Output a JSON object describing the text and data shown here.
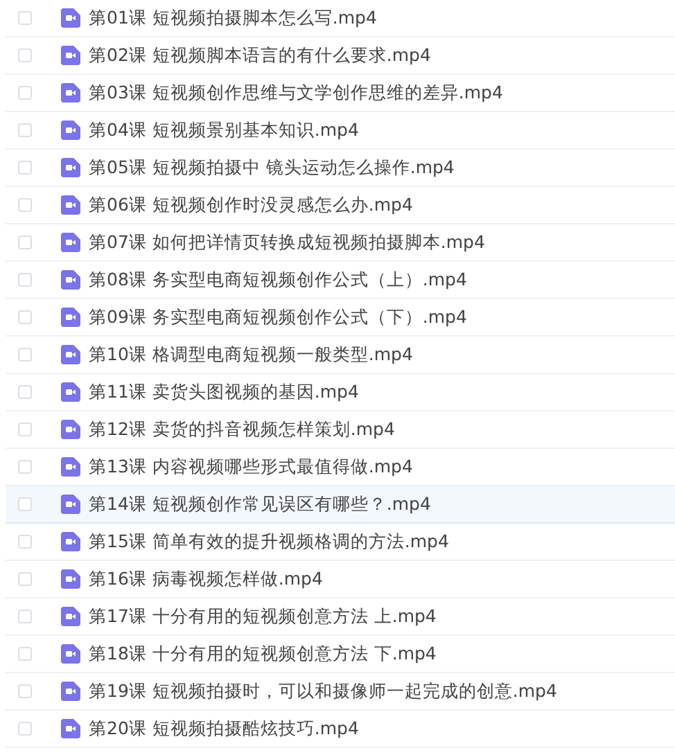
{
  "files": [
    {
      "name": "第01课 短视频拍摄脚本怎么写.mp4",
      "checked": false,
      "selected": false
    },
    {
      "name": "第02课 短视频脚本语言的有什么要求.mp4",
      "checked": false,
      "selected": false
    },
    {
      "name": "第03课 短视频创作思维与文学创作思维的差异.mp4",
      "checked": false,
      "selected": false
    },
    {
      "name": "第04课 短视频景别基本知识.mp4",
      "checked": false,
      "selected": false
    },
    {
      "name": "第05课 短视频拍摄中 镜头运动怎么操作.mp4",
      "checked": false,
      "selected": false
    },
    {
      "name": "第06课 短视频创作时没灵感怎么办.mp4",
      "checked": false,
      "selected": false
    },
    {
      "name": "第07课 如何把详情页转换成短视频拍摄脚本.mp4",
      "checked": false,
      "selected": false
    },
    {
      "name": "第08课 务实型电商短视频创作公式（上）.mp4",
      "checked": false,
      "selected": false
    },
    {
      "name": "第09课 务实型电商短视频创作公式（下）.mp4",
      "checked": false,
      "selected": false
    },
    {
      "name": "第10课 格调型电商短视频一般类型.mp4",
      "checked": false,
      "selected": false
    },
    {
      "name": "第11课 卖货头图视频的基因.mp4",
      "checked": false,
      "selected": false
    },
    {
      "name": "第12课 卖货的抖音视频怎样策划.mp4",
      "checked": false,
      "selected": false
    },
    {
      "name": "第13课 内容视频哪些形式最值得做.mp4",
      "checked": false,
      "selected": false
    },
    {
      "name": "第14课 短视频创作常见误区有哪些？.mp4",
      "checked": false,
      "selected": true
    },
    {
      "name": "第15课 简单有效的提升视频格调的方法.mp4",
      "checked": false,
      "selected": false
    },
    {
      "name": "第16课 病毒视频怎样做.mp4",
      "checked": false,
      "selected": false
    },
    {
      "name": "第17课 十分有用的短视频创意方法 上.mp4",
      "checked": false,
      "selected": false
    },
    {
      "name": "第18课 十分有用的短视频创意方法 下.mp4",
      "checked": false,
      "selected": false
    },
    {
      "name": "第19课 短视频拍摄时，可以和摄像师一起完成的创意.mp4",
      "checked": false,
      "selected": false
    },
    {
      "name": "第20课 短视频拍摄酷炫技巧.mp4",
      "checked": false,
      "selected": false
    }
  ]
}
